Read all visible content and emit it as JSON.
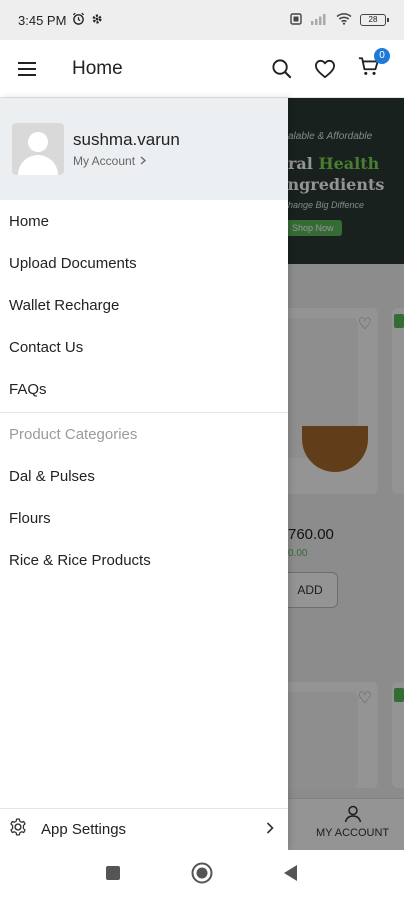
{
  "status_bar": {
    "time": "3:45 PM",
    "battery": "28"
  },
  "app_bar": {
    "title": "Home",
    "cart_count": "0"
  },
  "drawer": {
    "user": {
      "name": "sushma.varun",
      "account_link": "My Account"
    },
    "menu_items": [
      {
        "label": "Home"
      },
      {
        "label": "Upload Documents"
      },
      {
        "label": "Wallet Recharge"
      },
      {
        "label": "Contact Us"
      },
      {
        "label": "FAQs"
      }
    ],
    "section_title": "Product Categories",
    "categories": [
      {
        "label": "Dal & Pulses"
      },
      {
        "label": "Flours"
      },
      {
        "label": "Rice & Rice Products"
      }
    ],
    "footer": {
      "label": "App Settings"
    }
  },
  "background": {
    "banner": {
      "line1": "alable & Affordable",
      "line2_part1": "ral ",
      "line2_part2": "Health",
      "line3": "Ingredients",
      "line4": "hange Big Diffence",
      "button": "Shop Now"
    },
    "product": {
      "price": "760.00",
      "mrp": "0.00",
      "add_label": "ADD"
    },
    "bottom_nav_label": "MY ACCOUNT"
  },
  "colors": {
    "accent_blue": "#1e7ad8",
    "drawer_header": "#eceff2",
    "green": "#5cb85c"
  }
}
